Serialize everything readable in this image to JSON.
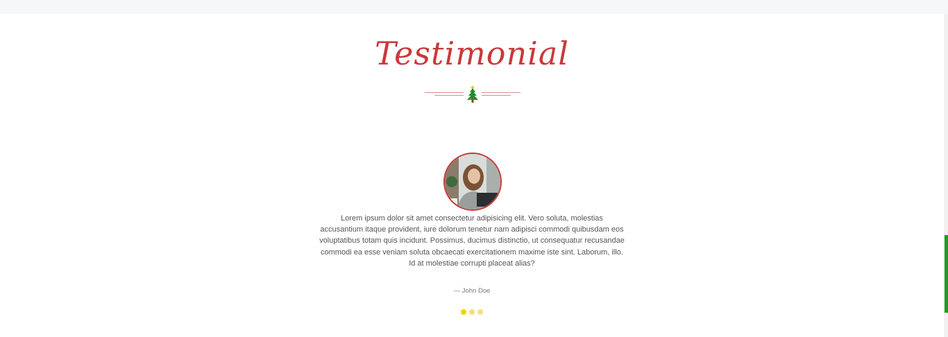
{
  "section": {
    "title": "Testimonial"
  },
  "testimonial": {
    "quote": "Lorem ipsum dolor sit amet consectetur adipisicing elit. Vero soluta, molestias accusantium itaque provident, iure dolorum tenetur nam adipisci commodi quibusdam eos voluptatibus totam quis incidunt. Possimus, ducimus distinctio, ut consequatur recusandae commodi ea esse veniam soluta obcaecati exercitationem maxime iste sint. Laborum, illo. Id at molestiae corrupti placeat alias?",
    "author": "— John Doe"
  },
  "carousel": {
    "dots": [
      {
        "active": true
      },
      {
        "active": false
      },
      {
        "active": false
      }
    ]
  },
  "icons": {
    "divider": "christmas-tree-icon"
  },
  "colors": {
    "accent": "#c9393a",
    "dot_active": "#f2d000",
    "dot_inactive": "#f5e07a",
    "scroll_thumb": "#1a9f1a"
  }
}
